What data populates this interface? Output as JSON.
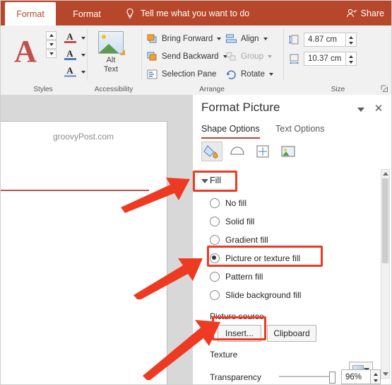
{
  "app": {
    "ribbon": {
      "tabs": [
        {
          "label": "Format",
          "active": true
        },
        {
          "label": "Format",
          "active": false
        }
      ],
      "tell_me": "Tell me what you want to do",
      "share": "Share",
      "groups": [
        {
          "label": "Styles"
        },
        {
          "label": "Accessibility"
        },
        {
          "label": "Arrange"
        },
        {
          "label": "Size"
        }
      ],
      "alt_text_button": {
        "line1": "Alt",
        "line2": "Text"
      },
      "arrange": [
        {
          "label": "Bring Forward",
          "icon": "bring-forward-icon",
          "enabled": true,
          "has_caret": true
        },
        {
          "label": "Send Backward",
          "icon": "send-backward-icon",
          "enabled": true,
          "has_caret": true
        },
        {
          "label": "Selection Pane",
          "icon": "selection-pane-icon",
          "enabled": true,
          "has_caret": false
        },
        {
          "label": "Align",
          "icon": "align-icon",
          "enabled": true,
          "has_caret": true
        },
        {
          "label": "Group",
          "icon": "group-icon",
          "enabled": false,
          "has_caret": true
        },
        {
          "label": "Rotate",
          "icon": "rotate-icon",
          "enabled": true,
          "has_caret": true
        }
      ],
      "size": {
        "height_value": "4.87 cm",
        "width_value": "10.37 cm",
        "height_icon": "shape-height-icon",
        "width_icon": "shape-width-icon"
      }
    },
    "slide": {
      "watermark": "groovyPost.com"
    },
    "pane": {
      "title": "Format Picture",
      "collapse_icon": "chevron-down-icon",
      "close_icon": "close-icon",
      "tabs": [
        {
          "label": "Shape Options",
          "active": true
        },
        {
          "label": "Text Options",
          "active": false
        }
      ],
      "icon_buttons": [
        {
          "name": "fill-and-line-icon",
          "selected": true
        },
        {
          "name": "effects-icon",
          "selected": false
        },
        {
          "name": "size-and-properties-icon",
          "selected": false
        },
        {
          "name": "picture-icon",
          "selected": false
        }
      ],
      "fill": {
        "heading": "Fill",
        "options": [
          {
            "label": "No fill",
            "selected": false
          },
          {
            "label": "Solid fill",
            "selected": false
          },
          {
            "label": "Gradient fill",
            "selected": false
          },
          {
            "label": "Picture or texture fill",
            "selected": true
          },
          {
            "label": "Pattern fill",
            "selected": false
          },
          {
            "label": "Slide background fill",
            "selected": false
          }
        ],
        "picture_source_label": "Picture source",
        "insert_button": "Insert...",
        "clipboard_button": "Clipboard",
        "texture_label": "Texture",
        "transparency_label": "Transparency",
        "transparency_value": "96%"
      }
    },
    "annotations": {
      "highlight_count": 3,
      "arrow_count": 3,
      "color": "#ed3b23"
    }
  }
}
